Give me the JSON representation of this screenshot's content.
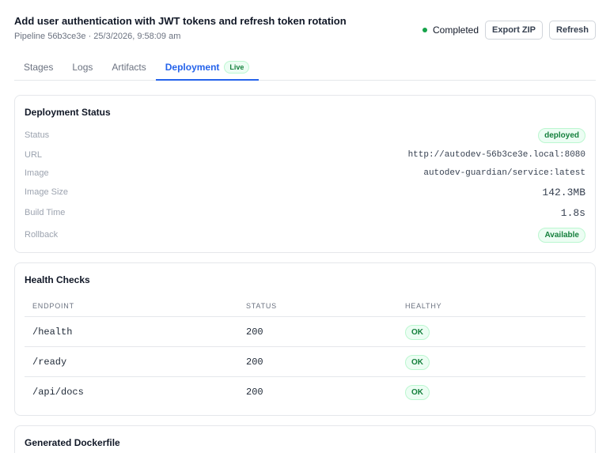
{
  "header": {
    "title": "Add user authentication with JWT tokens and refresh token rotation",
    "subtitle": "Pipeline 56b3ce3e · 25/3/2026, 9:58:09 am",
    "status_label": "Completed",
    "status_color": "#16a34a",
    "export_label": "Export ZIP",
    "refresh_label": "Refresh"
  },
  "tabs": [
    {
      "label": "Stages"
    },
    {
      "label": "Logs"
    },
    {
      "label": "Artifacts"
    },
    {
      "label": "Deployment",
      "badge": "Live",
      "active": true
    }
  ],
  "deployment_status": {
    "title": "Deployment Status",
    "rows": [
      {
        "label": "Status",
        "value": "deployed"
      },
      {
        "label": "URL",
        "value": "http://autodev-56b3ce3e.local:8080"
      },
      {
        "label": "Image",
        "value": "autodev-guardian/service:latest"
      },
      {
        "label": "Image Size",
        "value": "142.3MB"
      },
      {
        "label": "Build Time",
        "value": "1.8s"
      },
      {
        "label": "Rollback",
        "value": "Available"
      }
    ]
  },
  "health_checks": {
    "title": "Health Checks",
    "columns": [
      "ENDPOINT",
      "STATUS",
      "HEALTHY"
    ],
    "rows": [
      {
        "endpoint": "/health",
        "status": "200",
        "healthy": "OK"
      },
      {
        "endpoint": "/ready",
        "status": "200",
        "healthy": "OK"
      },
      {
        "endpoint": "/api/docs",
        "status": "200",
        "healthy": "OK"
      }
    ]
  },
  "dockerfile": {
    "title": "Generated Dockerfile"
  },
  "colors": {
    "accent": "#2563eb",
    "success": "#15803d"
  }
}
